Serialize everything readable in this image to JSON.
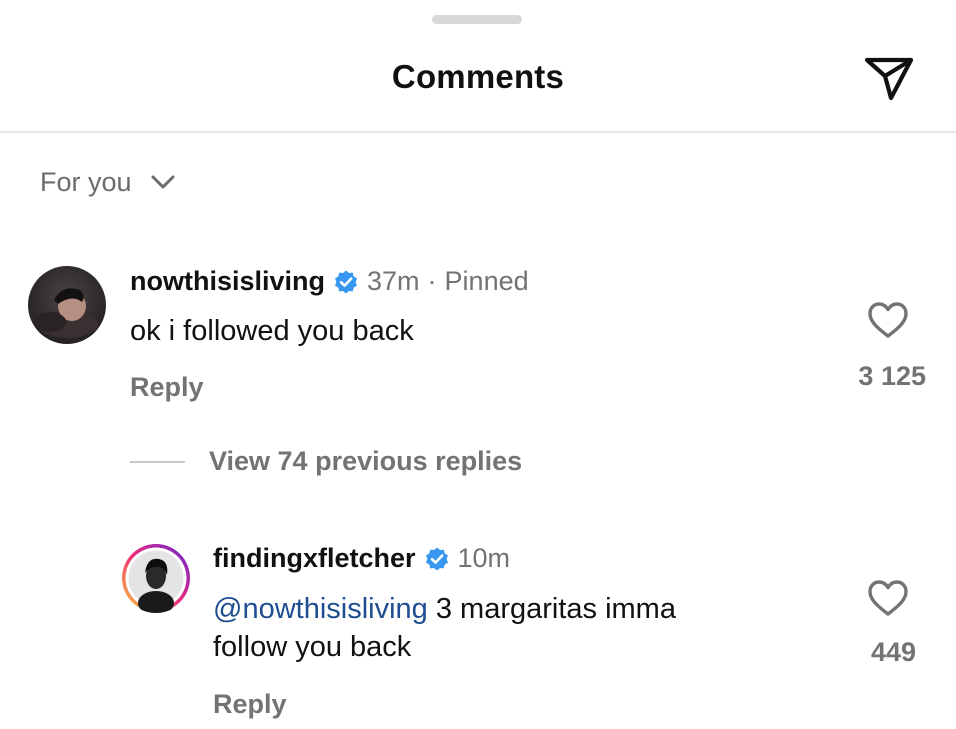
{
  "header": {
    "title": "Comments",
    "send_icon": "send-icon"
  },
  "sort": {
    "label": "For you",
    "icon": "chevron-down-icon"
  },
  "comments": [
    {
      "username": "nowthisisliving",
      "verified": true,
      "time": "37m",
      "separator": "·",
      "status": "Pinned",
      "text": "ok i followed you back",
      "reply_label": "Reply",
      "like_count": "3 125",
      "like_icon": "heart-outline-icon"
    }
  ],
  "view_replies": {
    "label": "View 74 previous replies"
  },
  "replies": [
    {
      "username": "findingxfletcher",
      "verified": true,
      "time": "10m",
      "mention": "@nowthisisliving",
      "text_line1": " 3 margaritas imma",
      "text_line2": "follow you back",
      "reply_label": "Reply",
      "like_count": "449",
      "like_icon": "heart-outline-icon"
    }
  ],
  "colors": {
    "verified_badge": "#3897f0",
    "mention": "#1f4d91",
    "secondary_text": "#737373",
    "story_ring_start": "#f9ce34",
    "story_ring_end": "#c13584"
  }
}
